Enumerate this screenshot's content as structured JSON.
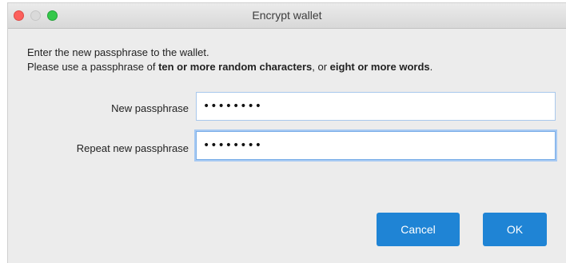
{
  "window": {
    "title": "Encrypt wallet",
    "controls": {
      "close": "close-icon",
      "minimize": "minimize-icon",
      "maximize": "maximize-icon"
    }
  },
  "description": {
    "line1": "Enter the new passphrase to the wallet.",
    "line2_prefix": "Please use a passphrase of ",
    "line2_bold1": "ten or more random characters",
    "line2_mid": ", or ",
    "line2_bold2": "eight or more words",
    "line2_suffix": "."
  },
  "fields": {
    "new_passphrase": {
      "label": "New passphrase",
      "value": "••••••••"
    },
    "repeat_passphrase": {
      "label": "Repeat new passphrase",
      "value": "••••••••"
    }
  },
  "buttons": {
    "cancel": "Cancel",
    "ok": "OK"
  },
  "colors": {
    "accent": "#1f84d5",
    "window_bg": "#ececec",
    "close": "#fc605c",
    "minimize": "#dadada",
    "maximize": "#34c84a",
    "focus_ring": "#a6c9f3"
  }
}
